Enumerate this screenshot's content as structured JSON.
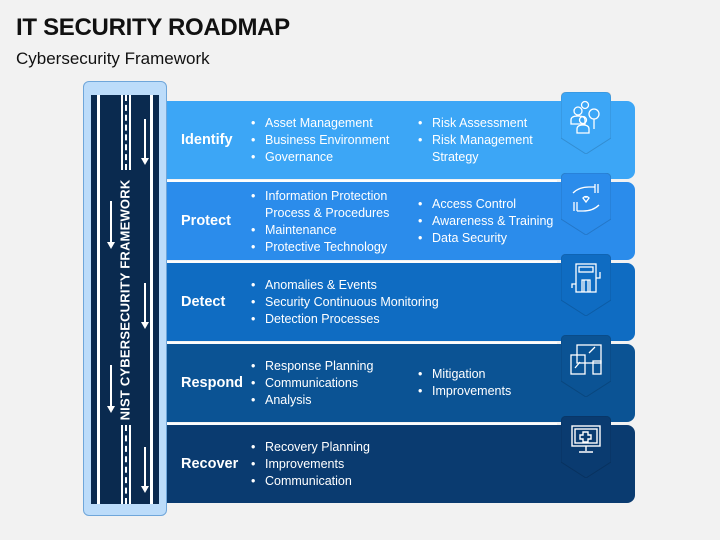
{
  "header": {
    "title": "IT SECURITY ROADMAP",
    "subtitle": "Cybersecurity Framework"
  },
  "road": {
    "label": "NIST CYBERSECURITY FRAMEWORK"
  },
  "rows": [
    {
      "name": "Identify",
      "color": "#3ca6f6",
      "icon": "team-search-icon",
      "col1": [
        "Asset Management",
        "Business Environment",
        "Governance"
      ],
      "col2": [
        "Risk Assessment",
        "Risk Management Strategy"
      ]
    },
    {
      "name": "Protect",
      "color": "#2b8ceb",
      "icon": "hands-heart-icon",
      "col1": [
        "Information Protection Process & Procedures",
        "Maintenance",
        "Protective Technology"
      ],
      "col2": [
        "Access Control",
        "Awareness & Training",
        "Data Security"
      ]
    },
    {
      "name": "Detect",
      "color": "#0f6cc2",
      "icon": "security-machine-icon",
      "col1": [
        "Anomalies & Events",
        "Security Continuous Monitoring",
        "Detection Processes"
      ],
      "col2": []
    },
    {
      "name": "Respond",
      "color": "#0b5394",
      "icon": "devices-icon",
      "col1": [
        "Response Planning",
        "Communications",
        "Analysis"
      ],
      "col2": [
        "Mitigation",
        "Improvements"
      ]
    },
    {
      "name": "Recover",
      "color": "#0a3b70",
      "icon": "monitor-health-icon",
      "col1": [
        "Recovery Planning",
        "Improvements",
        "Communication"
      ],
      "col2": []
    }
  ]
}
